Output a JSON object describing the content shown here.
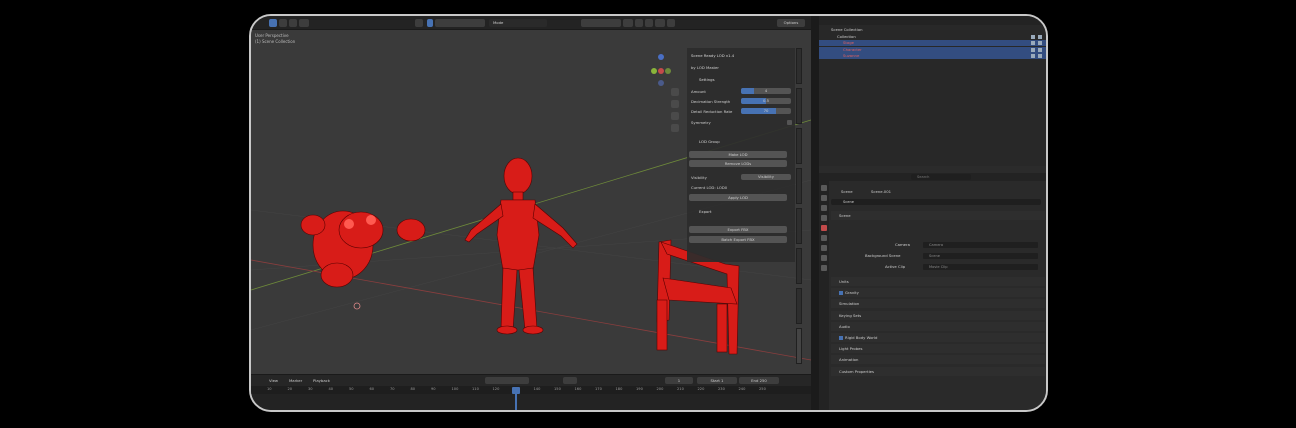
{
  "viewport": {
    "mode_label": "User Perspective",
    "collection_label": "(1) Scene Collection",
    "header_search": "Mode",
    "options_label": "Options",
    "colors": {
      "mesh": "#e0201c",
      "background": "#3a3a3a",
      "x_axis": "#8a3e3e",
      "y_axis": "#6e8a3a"
    }
  },
  "npanel": {
    "addon_title": "Scene Ready LOD v1.4",
    "subtitle": "by LOD Master",
    "settings_header": "Settings",
    "fields": [
      {
        "label": "Amount",
        "value": "4",
        "fill": 0.25
      },
      {
        "label": "Decimation Strength",
        "value": "0.5",
        "fill": 0.5
      },
      {
        "label": "Detail Reduction Rate",
        "value": "70",
        "fill": 0.7
      }
    ],
    "symmetry_label": "Symmetry",
    "lod_group_header": "LOD Group",
    "make_lod": "Make LOD",
    "remove_lod": "Remove LODs",
    "visibility_label": "Visibility",
    "visibility_value": "Visibility",
    "current_label": "Current LOD: LOD0",
    "apply_lod": "Apply LOD",
    "export_header": "Export",
    "export_fbx": "Export FBX",
    "batch_export": "Batch Export FBX"
  },
  "tabs": [
    "Item",
    "Tool",
    "View",
    "Create",
    "Animate",
    "Edit",
    "LOD Tools",
    "Scene Ready"
  ],
  "timeline": {
    "menu": [
      "View",
      "Marker",
      "Playback"
    ],
    "current_frame": "1",
    "start_label": "Start",
    "start_value": "1",
    "end_label": "End",
    "end_value": "250",
    "ticks": [
      "10",
      "20",
      "30",
      "40",
      "50",
      "60",
      "70",
      "80",
      "90",
      "100",
      "110",
      "120",
      "130",
      "140",
      "150",
      "160",
      "170",
      "180",
      "190",
      "200",
      "210",
      "220",
      "230",
      "240",
      "250"
    ]
  },
  "outliner": {
    "search_placeholder": "",
    "items": [
      {
        "name": "Scene Collection",
        "selected": false,
        "color": ""
      },
      {
        "name": "Collection",
        "selected": false,
        "color": ""
      },
      {
        "name": "Stage",
        "selected": true,
        "color": "red"
      },
      {
        "name": "Character",
        "selected": true,
        "color": "red"
      },
      {
        "name": "Suzanne",
        "selected": true,
        "color": "red"
      }
    ]
  },
  "properties": {
    "search_placeholder": "Search",
    "breadcrumb_scene": "Scene",
    "breadcrumb_data": "Scene.001",
    "scene_name": "Scene",
    "scene_section": "Scene",
    "camera_label": "Camera",
    "camera_value": "Camera",
    "background_label": "Background Scene",
    "background_value": "Scene",
    "active_clip_label": "Active Clip",
    "active_clip_value": "Movie Clip",
    "sections": [
      "Units",
      "Gravity",
      "Simulation",
      "Keying Sets",
      "Audio",
      "Rigid Body World",
      "Light Probes",
      "Animation",
      "Custom Properties"
    ],
    "checked_sections": [
      "Gravity",
      "Rigid Body World"
    ]
  }
}
